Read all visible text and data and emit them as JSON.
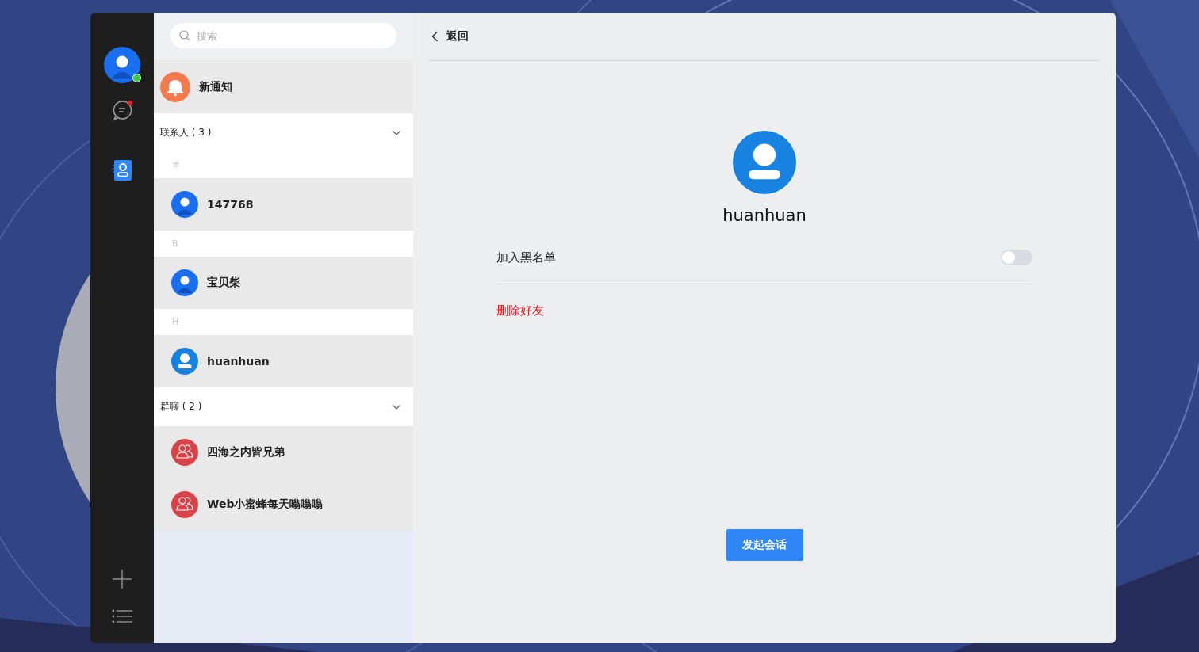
{
  "rail": {
    "user_online": true,
    "nav": [
      {
        "kind": "chat",
        "selected": false,
        "unread": true
      },
      {
        "kind": "contacts",
        "selected": true,
        "unread": false
      }
    ]
  },
  "search": {
    "placeholder": "搜索"
  },
  "notifications": {
    "label": "新通知"
  },
  "contacts": {
    "title": "联系人 ( 3 )",
    "expanded": true,
    "sections": [
      {
        "letter": "#",
        "items": [
          {
            "name": "147768",
            "kind": "person"
          }
        ]
      },
      {
        "letter": "B",
        "items": [
          {
            "name": "宝贝柴",
            "kind": "person"
          }
        ]
      },
      {
        "letter": "H",
        "items": [
          {
            "name": "huanhuan",
            "kind": "default"
          }
        ]
      }
    ]
  },
  "groups": {
    "title": "群聊 ( 2 )",
    "expanded": true,
    "items": [
      {
        "name": "四海之内皆兄弟",
        "kind": "group"
      },
      {
        "name": "Web小蜜蜂每天嗡嗡嗡",
        "kind": "group"
      }
    ]
  },
  "detail": {
    "back": "返回",
    "name": "huanhuan",
    "kind": "default",
    "blacklist": {
      "label": "加入黑名单",
      "on": false
    },
    "delete": "删除好友",
    "start_button": "发起会话"
  }
}
